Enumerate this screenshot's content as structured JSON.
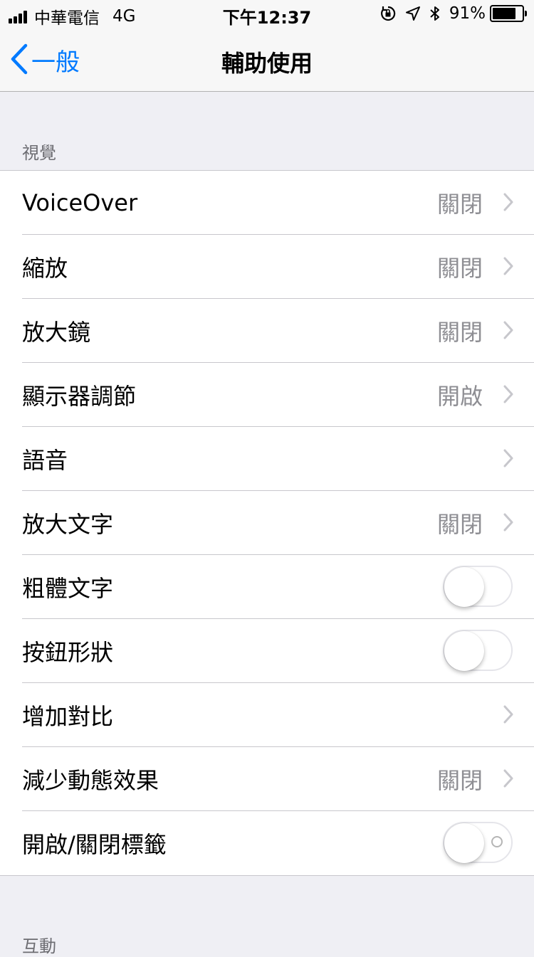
{
  "status_bar": {
    "carrier": "中華電信",
    "network": "4G",
    "time": "下午12:37",
    "battery_percent": "91%",
    "battery_level": 0.91,
    "icons": [
      "signal-icon",
      "orientation-lock-icon",
      "location-icon",
      "bluetooth-icon",
      "battery-icon"
    ]
  },
  "nav": {
    "back_label": "一般",
    "title": "輔助使用"
  },
  "sections": [
    {
      "header": "視覺",
      "rows": [
        {
          "label": "VoiceOver",
          "value": "關閉",
          "type": "disclosure"
        },
        {
          "label": "縮放",
          "value": "關閉",
          "type": "disclosure"
        },
        {
          "label": "放大鏡",
          "value": "關閉",
          "type": "disclosure"
        },
        {
          "label": "顯示器調節",
          "value": "開啟",
          "type": "disclosure"
        },
        {
          "label": "語音",
          "value": "",
          "type": "disclosure"
        },
        {
          "label": "放大文字",
          "value": "關閉",
          "type": "disclosure"
        },
        {
          "label": "粗體文字",
          "type": "toggle",
          "on": false
        },
        {
          "label": "按鈕形狀",
          "type": "toggle",
          "on": false
        },
        {
          "label": "增加對比",
          "value": "",
          "type": "disclosure"
        },
        {
          "label": "減少動態效果",
          "value": "關閉",
          "type": "disclosure"
        },
        {
          "label": "開啟/關閉標籤",
          "type": "toggle",
          "on": false,
          "labels_on": true
        }
      ]
    },
    {
      "header": "互動"
    }
  ],
  "colors": {
    "accent": "#007aff",
    "background": "#efeff4",
    "secondary_text": "#8e8e93",
    "separator": "#c8c7cc"
  }
}
